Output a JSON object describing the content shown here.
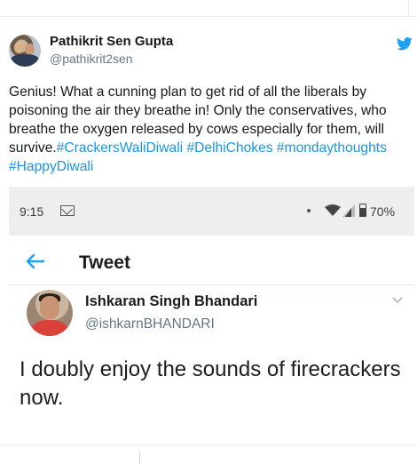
{
  "tweet": {
    "author_name": "Pathikrit Sen Gupta",
    "author_handle": "@pathikrit2sen",
    "text_plain": "Genius! What a cunning plan to get rid of all the liberals by poisoning the air they breathe in! Only the conservatives, who breathe the oxygen released by cows especially for them, will survive.",
    "hashtags": [
      "#CrackersWaliDiwali",
      "#DelhiChokes",
      "#mondaythoughts",
      "#HappyDiwali"
    ],
    "hashtag_color": "#1b95e0",
    "bird_icon": "twitter-bird-icon",
    "bird_color": "#1da1f2"
  },
  "screenshot": {
    "status_bar": {
      "time": "9:15",
      "battery_pct": "70%",
      "battery_level": 0.7,
      "icons": [
        "gmail-icon",
        "dot-icon",
        "wifi-icon",
        "signal-icon",
        "battery-icon"
      ]
    },
    "header": {
      "back_icon": "arrow-left-icon",
      "title": "Tweet",
      "accent": "#1da1f2"
    },
    "inner_tweet": {
      "author_name": "Ishkaran Singh Bhandari",
      "author_handle": "@ishkarnBHANDARI",
      "text": "I doubly enjoy the sounds of firecrackers now.",
      "menu_icon": "chevron-down-icon"
    }
  }
}
